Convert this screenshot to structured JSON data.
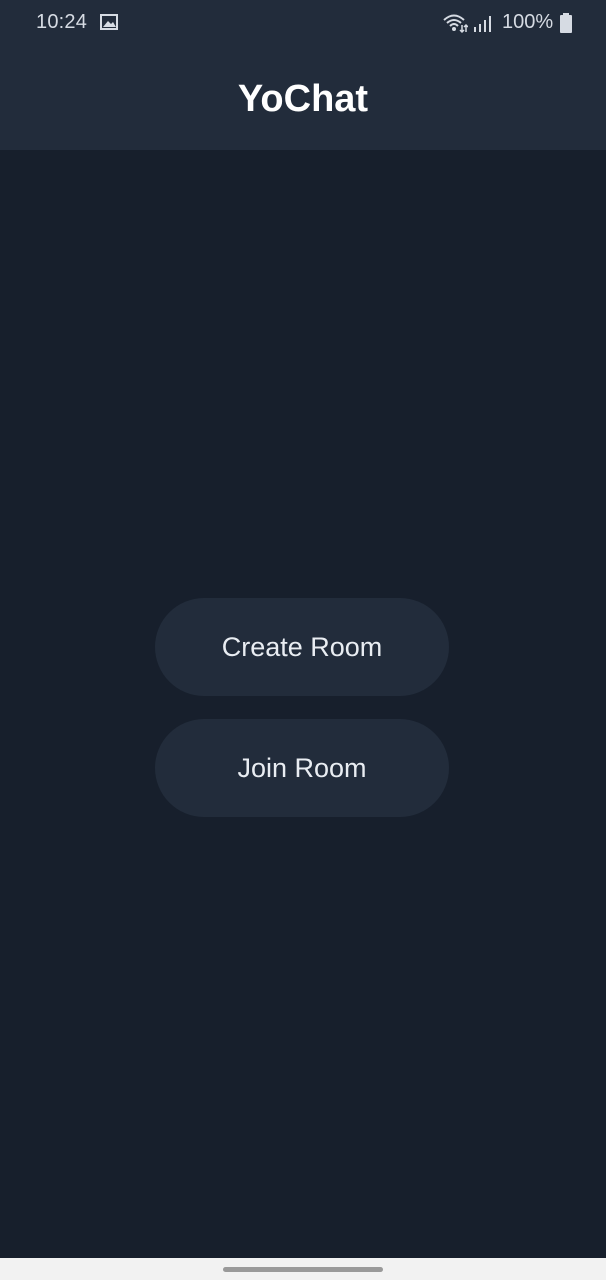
{
  "status_bar": {
    "time": "10:24",
    "battery": "100%",
    "icons": [
      "gallery-icon",
      "wifi-icon",
      "signal-icon",
      "battery-icon"
    ]
  },
  "header": {
    "title": "YoChat"
  },
  "actions": {
    "create_room_label": "Create Room",
    "join_room_label": "Join Room"
  },
  "colors": {
    "background": "#171f2c",
    "header": "#222c3b",
    "button": "#222c3b",
    "title_text": "#ffffff",
    "button_text": "#e9edf2",
    "status_text": "#d6dbe3",
    "nav_bar": "#f2f2f2",
    "home_indicator": "#9a9a9a"
  }
}
